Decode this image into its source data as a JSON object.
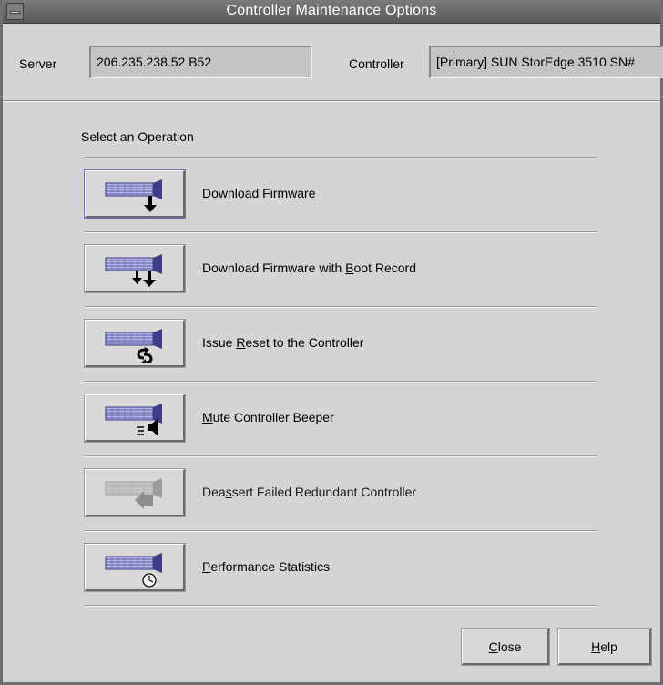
{
  "window": {
    "title": "Controller Maintenance Options"
  },
  "server": {
    "label": "Server",
    "value": "206.235.238.52 B52"
  },
  "controller": {
    "label": "Controller",
    "value": "[Primary] SUN StorEdge 3510 SN#"
  },
  "operations": {
    "heading": "Select an Operation",
    "items": [
      {
        "pre": "Download ",
        "mnemonic": "F",
        "post": "irmware",
        "icon": "download-firmware-icon",
        "enabled": true
      },
      {
        "pre": "Download Firmware with ",
        "mnemonic": "B",
        "post": "oot Record",
        "icon": "download-boot-record-icon",
        "enabled": true
      },
      {
        "pre": "Issue ",
        "mnemonic": "R",
        "post": "eset to the Controller",
        "icon": "reset-controller-icon",
        "enabled": true
      },
      {
        "pre": "",
        "mnemonic": "M",
        "post": "ute Controller Beeper",
        "icon": "mute-beeper-icon",
        "enabled": true
      },
      {
        "pre": "Dea",
        "mnemonic": "s",
        "post": "sert Failed Redundant Controller",
        "icon": "deassert-controller-icon",
        "enabled": false
      },
      {
        "pre": "",
        "mnemonic": "P",
        "post": "erformance Statistics",
        "icon": "performance-statistics-icon",
        "enabled": true
      }
    ]
  },
  "buttons": {
    "close": {
      "mnemonic": "C",
      "rest": "lose"
    },
    "help": {
      "mnemonic": "H",
      "rest": "elp"
    }
  },
  "colors": {
    "window_bg": "#d4d4d4",
    "titlebar": "#6a6a6a",
    "field_bg": "#c4c4c4",
    "icon_device": "#7d7dcc",
    "disabled_icon": "#a8a8a8"
  }
}
